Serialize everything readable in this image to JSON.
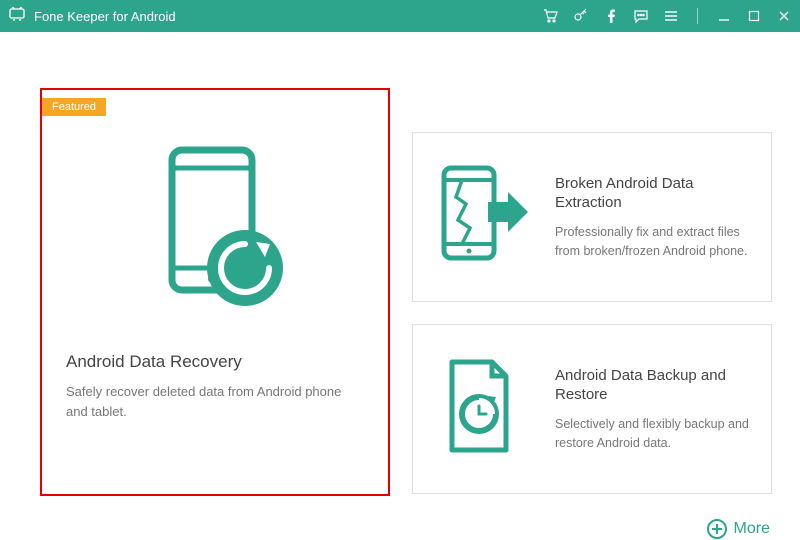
{
  "titlebar": {
    "app_name": "Fone Keeper for Android"
  },
  "featured": {
    "badge": "Featured",
    "title": "Android Data Recovery",
    "desc": "Safely recover deleted data from Android phone and tablet."
  },
  "broken": {
    "title": "Broken Android Data Extraction",
    "desc": "Professionally fix and extract files from broken/frozen Android phone."
  },
  "backup": {
    "title": "Android Data Backup and Restore",
    "desc": "Selectively and flexibly backup and restore Android data."
  },
  "more": {
    "label": "More"
  },
  "colors": {
    "accent": "#2da58d",
    "badge": "#f5a623",
    "highlight_border": "#e60000"
  }
}
